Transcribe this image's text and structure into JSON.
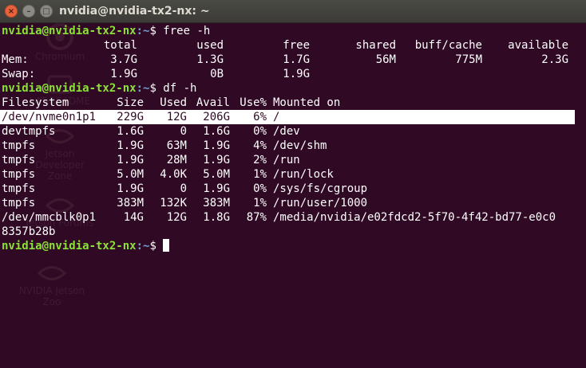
{
  "window": {
    "title": "nvidia@nvidia-tx2-nx: ~",
    "close_glyph": "×",
    "minimize_glyph": "–",
    "maximize_glyph": "□"
  },
  "prompt": {
    "user_host": "nvidia@nvidia-tx2-nx",
    "path": ":~",
    "symbol": "$"
  },
  "commands": {
    "free": " free -h",
    "df": " df -h",
    "current": " "
  },
  "free": {
    "headers": [
      "total",
      "used",
      "free",
      "shared",
      "buff/cache",
      "available"
    ],
    "rows": [
      {
        "label": "Mem:",
        "values": [
          "3.7G",
          "1.3G",
          "1.7G",
          "56M",
          "775M",
          "2.3G"
        ]
      },
      {
        "label": "Swap:",
        "values": [
          "1.9G",
          "0B",
          "1.9G",
          "",
          "",
          ""
        ]
      }
    ]
  },
  "df": {
    "headers": [
      "Filesystem",
      "Size",
      "Used",
      "Avail",
      "Use%",
      "Mounted on"
    ],
    "rows": [
      [
        "/dev/nvme0n1p1",
        "229G",
        "12G",
        "206G",
        "6%",
        "/"
      ],
      [
        "devtmpfs",
        "1.6G",
        "0",
        "1.6G",
        "0%",
        "/dev"
      ],
      [
        "tmpfs",
        "1.9G",
        "63M",
        "1.9G",
        "4%",
        "/dev/shm"
      ],
      [
        "tmpfs",
        "1.9G",
        "28M",
        "1.9G",
        "2%",
        "/run"
      ],
      [
        "tmpfs",
        "5.0M",
        "4.0K",
        "5.0M",
        "1%",
        "/run/lock"
      ],
      [
        "tmpfs",
        "1.9G",
        "0",
        "1.9G",
        "0%",
        "/sys/fs/cgroup"
      ],
      [
        "tmpfs",
        "383M",
        "132K",
        "383M",
        "1%",
        "/run/user/1000"
      ],
      [
        "/dev/mmcblk0p1",
        "14G",
        "12G",
        "1.8G",
        "87%",
        "/media/nvidia/e02fdcd2-5f70-4f42-bd77-e0c0"
      ]
    ],
    "wrapped_tail": "8357b28b",
    "highlighted_row": 0
  },
  "desktop_icons": [
    {
      "label": "Chromium",
      "icon": "chromium-icon"
    },
    {
      "label": "L4T-README",
      "icon": "drive-icon"
    },
    {
      "label": "Jetson Developer Zone",
      "icon": "nvidia-icon"
    },
    {
      "label": "Jetson Forums",
      "icon": "nvidia-icon"
    },
    {
      "label": "NVIDIA Jetson Zoo",
      "icon": "nvidia-icon"
    }
  ],
  "colors": {
    "background": "#300a24",
    "prompt_user": "#8ae234",
    "prompt_path": "#729fcf",
    "text": "#ffffff",
    "titlebar": "#3c3b37",
    "close_button": "#e8623c"
  }
}
